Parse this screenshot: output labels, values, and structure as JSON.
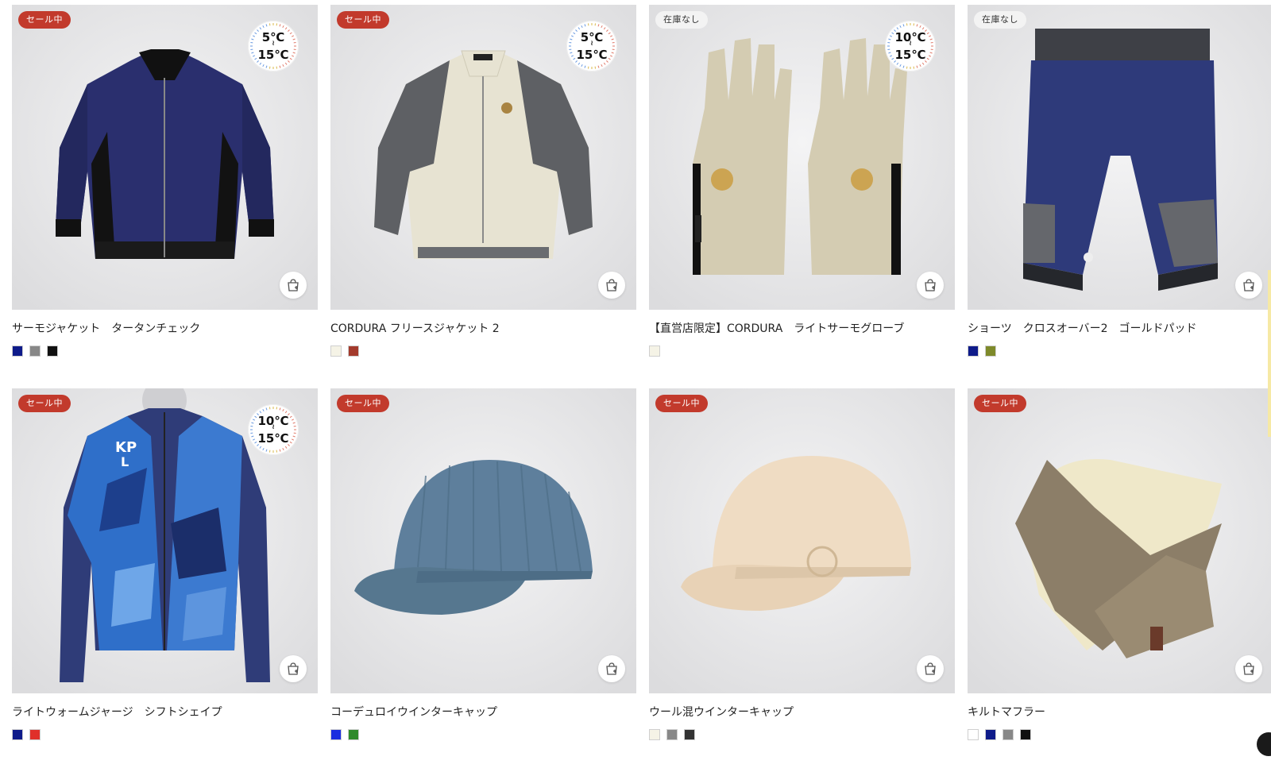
{
  "products": [
    {
      "name": "サーモジャケット　タータンチェック",
      "badge": "セール中",
      "badge_type": "sale",
      "temp": {
        "high": "5℃",
        "sep": "≀",
        "low": "15℃"
      },
      "swatches": [
        "#0e1b8a",
        "#888888",
        "#111111"
      ],
      "image": "jacket-navy"
    },
    {
      "name": "CORDURA フリースジャケット 2",
      "badge": "セール中",
      "badge_type": "sale",
      "temp": {
        "high": "5℃",
        "sep": "≀",
        "low": "15℃"
      },
      "swatches": [
        "#f5f3e6",
        "#a33a2c"
      ],
      "image": "jacket-cream"
    },
    {
      "name": "【直営店限定】CORDURA　ライトサーモグローブ",
      "badge": "在庫なし",
      "badge_type": "stock",
      "temp": {
        "high": "10℃",
        "sep": "≀",
        "low": "15℃"
      },
      "swatches": [
        "#f5f3e6"
      ],
      "image": "gloves"
    },
    {
      "name": "ショーツ　クロスオーバー2　ゴールドパッド",
      "badge": "在庫なし",
      "badge_type": "stock",
      "temp": null,
      "swatches": [
        "#0e1b8a",
        "#7e8a2a"
      ],
      "image": "shorts"
    },
    {
      "name": "ライトウォームジャージ　シフトシェイプ",
      "badge": "セール中",
      "badge_type": "sale",
      "temp": {
        "high": "10℃",
        "sep": "≀",
        "low": "15℃"
      },
      "swatches": [
        "#0e1b8a",
        "#e0302a"
      ],
      "image": "jersey-camo"
    },
    {
      "name": "コーデュロイウインターキャップ",
      "badge": "セール中",
      "badge_type": "sale",
      "temp": null,
      "swatches": [
        "#1a2ee0",
        "#2e8a2a"
      ],
      "image": "cap-blue"
    },
    {
      "name": "ウール混ウインターキャップ",
      "badge": "セール中",
      "badge_type": "sale",
      "temp": null,
      "swatches": [
        "#f5f3e6",
        "#888888",
        "#333333"
      ],
      "image": "cap-beige"
    },
    {
      "name": "キルトマフラー",
      "badge": "セール中",
      "badge_type": "sale",
      "temp": null,
      "swatches": [
        "#ffffff",
        "#0e1b8a",
        "#888888",
        "#111111"
      ],
      "image": "muffler"
    }
  ]
}
